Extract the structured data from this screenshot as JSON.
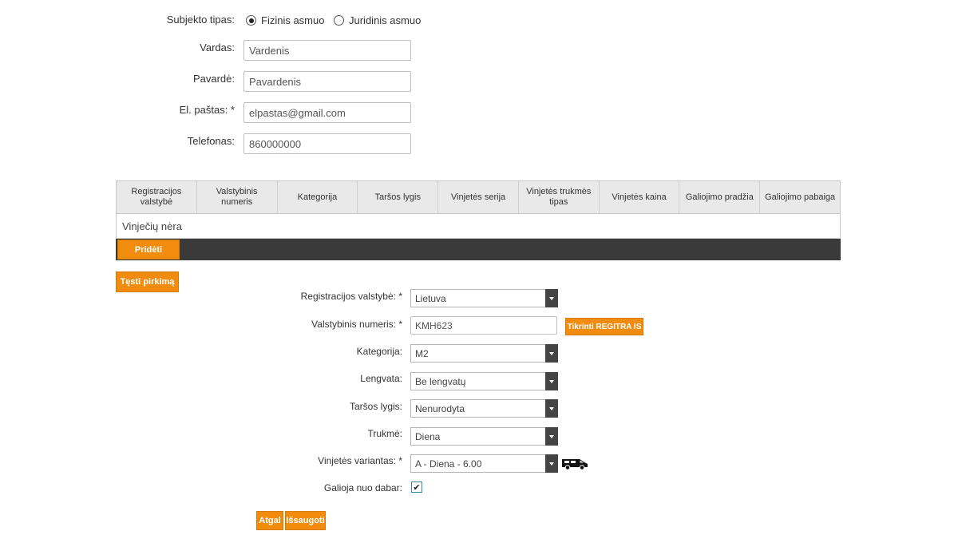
{
  "subject": {
    "label": "Subjekto tipas:",
    "options": [
      "Fizinis asmuo",
      "Juridinis asmuo"
    ],
    "selected": "Fizinis asmuo"
  },
  "form": {
    "first_name": {
      "label": "Vardas:",
      "value": "Vardenis"
    },
    "last_name": {
      "label": "Pavardė:",
      "value": "Pavardenis"
    },
    "email": {
      "label": "El. paštas: *",
      "value": "elpastas@gmail.com"
    },
    "phone": {
      "label": "Telefonas:",
      "value": "860000000"
    }
  },
  "table": {
    "headers": [
      "Registracijos valstybė",
      "Valstybinis numeris",
      "Kategorija",
      "Taršos lygis",
      "Vinjetės serija",
      "Vinjetės trukmės tipas",
      "Vinjetės kaina",
      "Galiojimo pradžia",
      "Galiojimo pabaiga"
    ],
    "empty_text": "Vinječių nėra",
    "add_label": "Pridėti"
  },
  "continue_label": "Tęsti pirkimą",
  "vignette": {
    "country": {
      "label": "Registracijos valstybė: *",
      "value": "Lietuva"
    },
    "plate": {
      "label": "Valstybinis numeris: *",
      "value": "KMH623",
      "check_label": "Tikrinti REGITRA IS"
    },
    "category": {
      "label": "Kategorija:",
      "value": "M2"
    },
    "discount": {
      "label": "Lengvata:",
      "value": "Be lengvatų"
    },
    "pollution": {
      "label": "Taršos lygis:",
      "value": "Nenurodyta"
    },
    "duration": {
      "label": "Trukmė:",
      "value": "Diena"
    },
    "variant": {
      "label": "Vinjetės variantas: *",
      "value": "A - Diena - 6.00",
      "icon": "van-icon"
    },
    "valid_now": {
      "label": "Galioja nuo dabar:",
      "checked": true
    }
  },
  "actions": {
    "back_label": "Atgal",
    "save_label": "Išsaugoti"
  },
  "colors": {
    "accent": "#f28c0f",
    "dark_bar": "#3a3a3a",
    "header_bg": "#e9e9e9"
  }
}
